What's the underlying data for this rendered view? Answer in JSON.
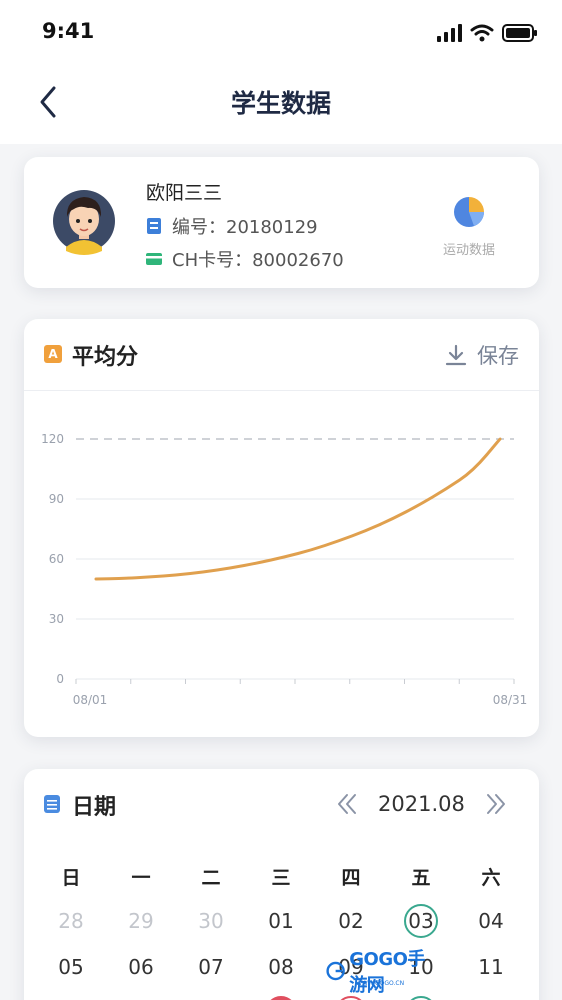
{
  "status_bar": {
    "time": "9:41"
  },
  "nav": {
    "title": "学生数据"
  },
  "profile": {
    "name": "欧阳三三",
    "id_text": "编号：20180129",
    "card_text": "CH卡号：80002670",
    "sport_label": "运动数据"
  },
  "chart_section": {
    "title": "平均分",
    "title_icon_letter": "A",
    "save_label": "保存"
  },
  "chart_data": {
    "type": "line",
    "title": "平均分",
    "x_labels": [
      "08/01",
      "08/31"
    ],
    "x": [
      1,
      31
    ],
    "y_ticks": [
      0,
      30,
      60,
      90,
      120
    ],
    "ylim": [
      0,
      120
    ],
    "series": [
      {
        "values": [
          50,
          50.3,
          51,
          52,
          53.5,
          55.5,
          58,
          61,
          64.5,
          69,
          74,
          80,
          87,
          95,
          104,
          120
        ]
      }
    ],
    "reference_line": 120,
    "line_color": "#e0a04e",
    "grid": true
  },
  "calendar": {
    "title": "日期",
    "month_label": "2021.08",
    "weekdays": [
      "日",
      "一",
      "二",
      "三",
      "四",
      "五",
      "六"
    ],
    "row1": [
      "28",
      "29",
      "30",
      "01",
      "02",
      "03",
      "04"
    ],
    "row2": [
      "05",
      "06",
      "07",
      "08",
      "09",
      "10",
      "11"
    ]
  },
  "watermark": {
    "text": "GOGO手游网",
    "sub": "WWW.GOGO.CN"
  },
  "colors": {
    "accent_line": "#e0a04e",
    "ring": "#3aa88f",
    "title_navy": "#1f2a44"
  }
}
